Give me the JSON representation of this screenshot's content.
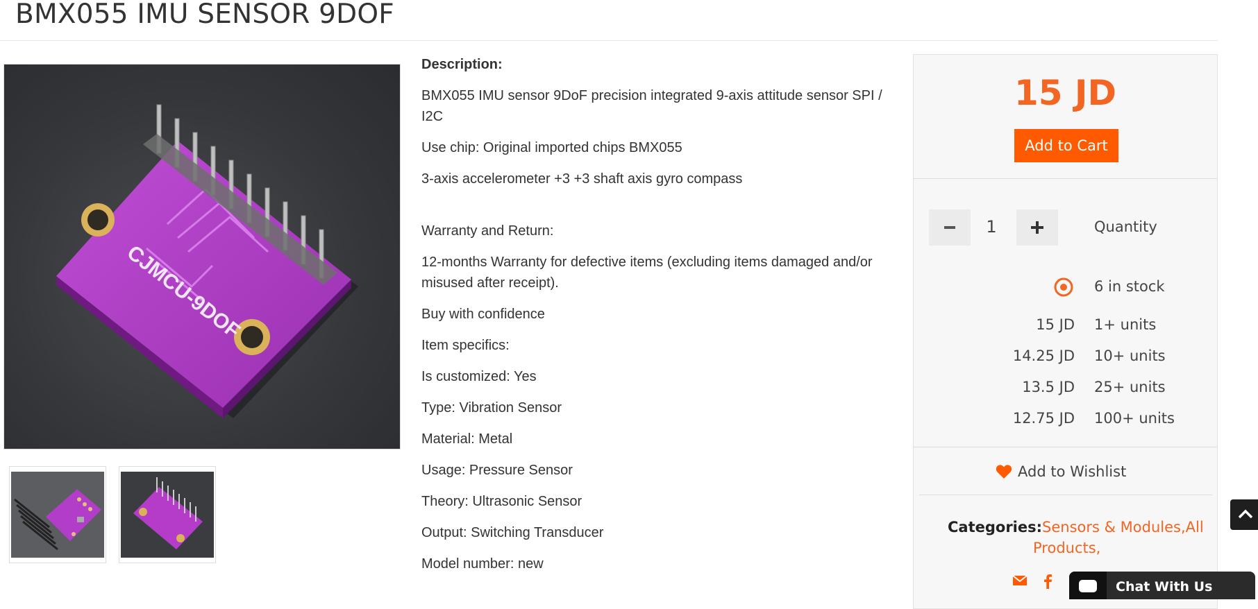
{
  "product": {
    "title": "BMX055 IMU SENSOR 9DOF"
  },
  "board_silkscreen": "CJMCU-9DOF",
  "description": {
    "heading": "Description:",
    "lines_top": [
      "BMX055 IMU sensor 9DoF precision integrated 9-axis attitude sensor SPI / I2C",
      "Use chip: Original imported chips BMX055",
      "3-axis accelerometer +3 +3 shaft axis gyro compass"
    ],
    "lines_bottom": [
      "Warranty and Return:",
      "12-months Warranty for defective items (excluding items damaged and/or misused after receipt).",
      "Buy with confidence",
      "Item specifics:",
      "Is customized: Yes",
      "Type: Vibration Sensor",
      "Material: Metal",
      "Usage: Pressure Sensor",
      "Theory: Ultrasonic Sensor",
      "Output: Switching Transducer",
      "Model number: new"
    ]
  },
  "purchase": {
    "price": "15 JD",
    "add_to_cart_label": "Add to Cart",
    "quantity_value": "1",
    "quantity_label": "Quantity",
    "stock_text": "6 in stock",
    "tiers": [
      {
        "price": "15 JD",
        "units": "1+ units"
      },
      {
        "price": "14.25 JD",
        "units": "10+ units"
      },
      {
        "price": "13.5 JD",
        "units": "25+ units"
      },
      {
        "price": "12.75 JD",
        "units": "100+ units"
      }
    ],
    "wishlist_label": "Add to Wishlist",
    "categories_label": "Categories:",
    "categories_links": "Sensors & Modules,All Products,"
  },
  "chat": {
    "label": "Chat With Us"
  },
  "colors": {
    "accent": "#f26522",
    "button": "#ff5a00",
    "board": "#b43cc8"
  },
  "icons": [
    "minus-icon",
    "plus-icon",
    "stock-radio-icon",
    "heart-icon",
    "email-icon",
    "facebook-icon",
    "chevron-up-icon",
    "chat-bubble-icon"
  ]
}
